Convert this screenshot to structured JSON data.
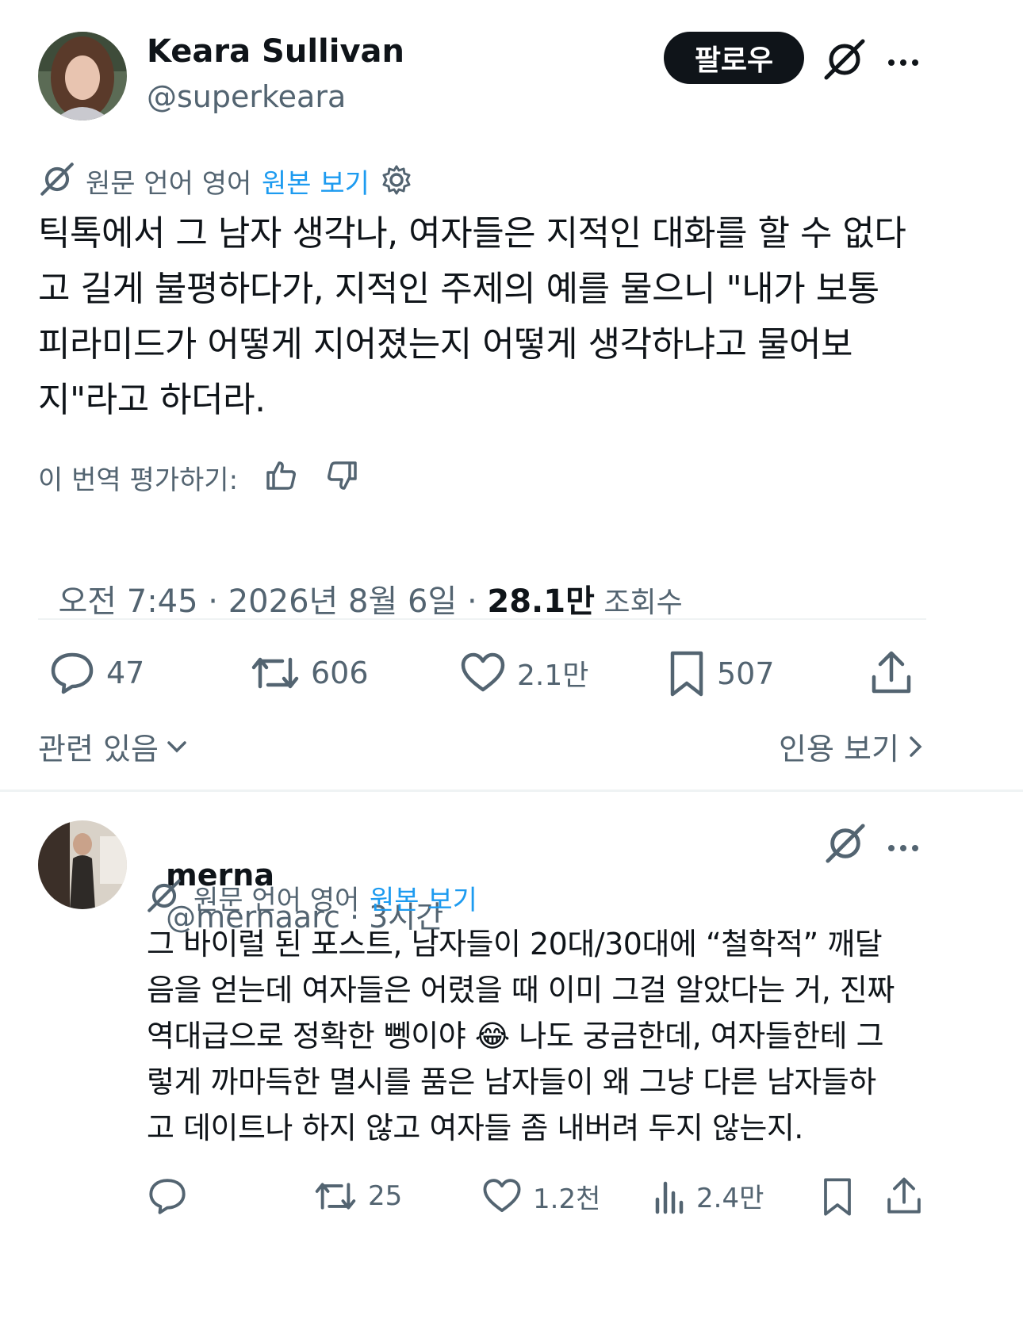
{
  "main_tweet": {
    "author_name": "Keara Sullivan",
    "author_handle": "@superkeara",
    "follow_label": "팔로우",
    "translation_note": "원문 언어 영어",
    "view_original": "원본 보기",
    "text": "틱톡에서 그 남자 생각나, 여자들은 지적인 대화를 할 수 없다고 길게 불평하다가, 지적인 주제의 예를 물으니 \"내가 보통 피라미드가 어떻게 지어졌는지 어떻게 생각하냐고 물어보지\"라고 하더라.",
    "text_lines": [
      "틱톡에서 그 남자 생각나, 여자들은 지적인 대화를 할 수 없다",
      "고 길게 불평하다가, 지적인 주제의 예를 물으니 \"내가 보통",
      "피라미드가 어떻게 지어졌는지 어떻게 생각하냐고 물어보",
      "지\"라고 하더라."
    ],
    "rate_translation": "이 번역 평가하기:",
    "timestamp": "오전 7:45 · 2026년 8월 6일 · ",
    "views_count": "28.1만",
    "views_label": " 조회수",
    "replies": "47",
    "reposts": "606",
    "likes": "2.1만",
    "bookmarks": "507",
    "related": "관련 있음",
    "view_quotes": "인용 보기"
  },
  "reply": {
    "author_name": "merna",
    "author_handle": "@mernaarc",
    "time": " · 3시간",
    "translation_note": "원문 언어 영어",
    "view_original": "원본 보기",
    "text_lines": [
      "그 바이럴 된 포스트, 남자들이 20대/30대에 “철학적” 깨달",
      "음을 얻는데 여자들은 어렸을 때 이미 그걸 알았다는 거, 진짜",
      "역대급으로 정확한 뼁이야 😂 나도 궁금한데, 여자들한테 그",
      "렇게 까마득한 멸시를 품은 남자들이 왜 그냥 다른 남자들하",
      "고 데이트나 하지 않고 여자들 좀 내버려 두지 않는지."
    ],
    "reposts": "25",
    "likes": "1.2천",
    "views": "2.4만"
  },
  "colors": {
    "text": "#0f1419",
    "secondary": "#536471",
    "link": "#1d9bf0",
    "divider": "#eff3f4"
  }
}
